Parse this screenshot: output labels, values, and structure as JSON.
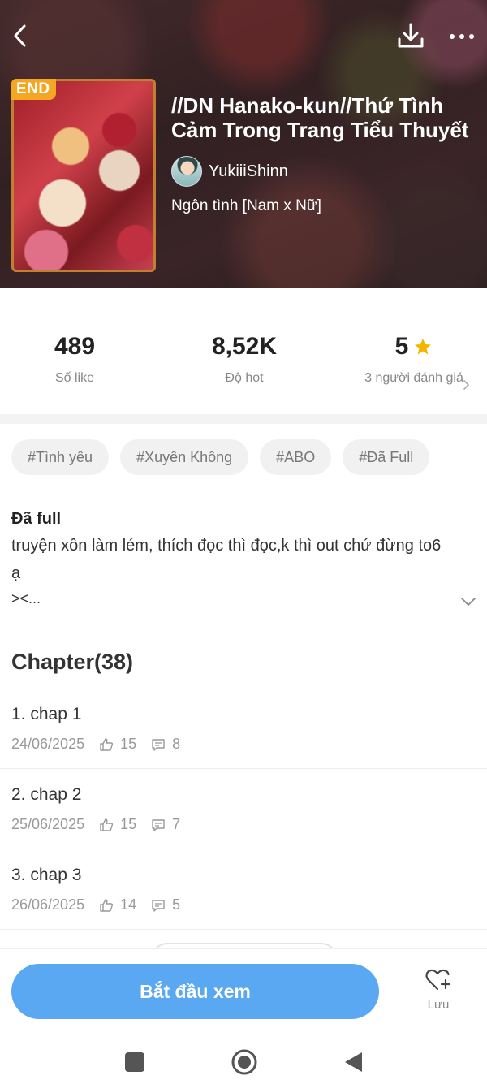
{
  "header": {
    "end_badge": "END",
    "title": "//DN Hanako-kun//Thứ Tình Cảm Trong Trang Tiểu Thuyết",
    "author": "YukiiiShinn",
    "genre": "Ngôn tình [Nam x Nữ]"
  },
  "stats": {
    "likes": {
      "value": "489",
      "label": "Số like"
    },
    "hot": {
      "value": "8,52K",
      "label": "Độ hot"
    },
    "rating": {
      "value": "5",
      "label": "3 người đánh giá"
    }
  },
  "tags": [
    "#Tình yêu",
    "#Xuyên Không",
    "#ABO",
    "#Đã Full"
  ],
  "description": {
    "title": "Đã full",
    "text": "truyện xồn làm lém, thích đọc thì đọc,k thì out chứ đừng to6 ạ",
    "more": "><..."
  },
  "chapters": {
    "heading": "Chapter(38)",
    "items": [
      {
        "title": "1. chap 1",
        "date": "24/06/2025",
        "likes": "15",
        "comments": "8"
      },
      {
        "title": "2. chap 2",
        "date": "25/06/2025",
        "likes": "15",
        "comments": "7"
      },
      {
        "title": "3. chap 3",
        "date": "26/06/2025",
        "likes": "14",
        "comments": "5"
      }
    ]
  },
  "actions": {
    "start_label": "Bắt đầu xem",
    "save_label": "Lưu"
  },
  "colors": {
    "accent": "#5aa8f2",
    "end_badge": "#f5a623",
    "star": "#f5b400"
  },
  "icons": {
    "back": "chevron-left-icon",
    "download": "download-icon",
    "more": "more-dots-icon",
    "star": "star-icon",
    "like": "thumb-up-icon",
    "comment": "comment-icon",
    "save": "heart-plus-icon"
  }
}
